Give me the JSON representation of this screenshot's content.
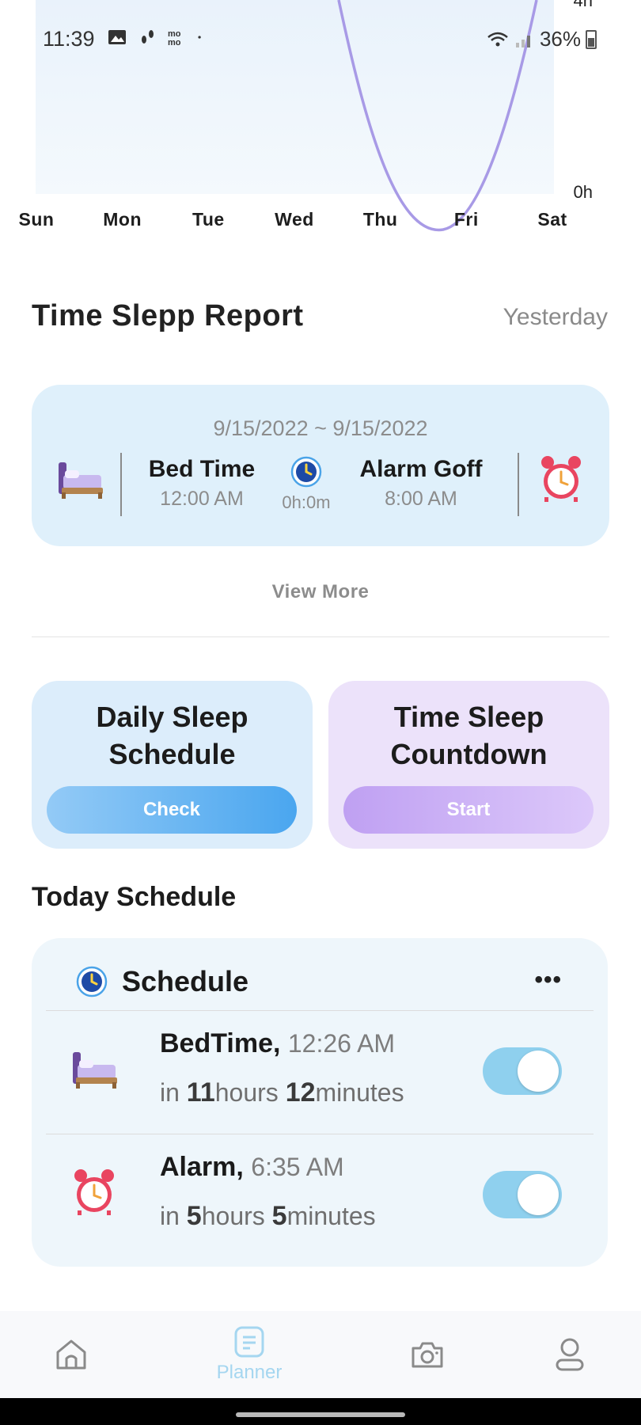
{
  "status_bar": {
    "time": "11:39",
    "battery": "36%"
  },
  "chart_data": {
    "type": "line",
    "categories": [
      "Sun",
      "Mon",
      "Tue",
      "Wed",
      "Thu",
      "Fri",
      "Sat"
    ],
    "y_tick_labels": [
      "4h",
      "0h"
    ],
    "ylim": [
      0,
      4
    ],
    "line_color": "#a89ae6"
  },
  "report": {
    "title": "Time Slepp Report",
    "range": "Yesterday",
    "dates": "9/15/2022 ~ 9/15/2022",
    "bed_title": "Bed Time",
    "bed_time": "12:00 AM",
    "duration": "0h:0m",
    "alarm_title": "Alarm Goff",
    "alarm_time": "8:00 AM",
    "view_more": "View More"
  },
  "actions": {
    "daily_title_1": "Daily Sleep",
    "daily_title_2": "Schedule",
    "daily_button": "Check",
    "countdown_title_1": "Time Sleep",
    "countdown_title_2": "Countdown",
    "countdown_button": "Start"
  },
  "today": {
    "title": "Today Schedule",
    "card_title": "Schedule",
    "more": "•••",
    "rows": [
      {
        "name": "BedTime,",
        "time": "12:26 AM",
        "in": "in",
        "hours": "11",
        "hours_unit": "hours",
        "minutes": "12",
        "minutes_unit": "minutes",
        "enabled": true
      },
      {
        "name": "Alarm,",
        "time": "6:35 AM",
        "in": "in",
        "hours": "5",
        "hours_unit": "hours",
        "minutes": "5",
        "minutes_unit": "minutes",
        "enabled": true
      }
    ]
  },
  "nav": {
    "active_label": "Planner",
    "accent_color": "#a5d6f0"
  }
}
